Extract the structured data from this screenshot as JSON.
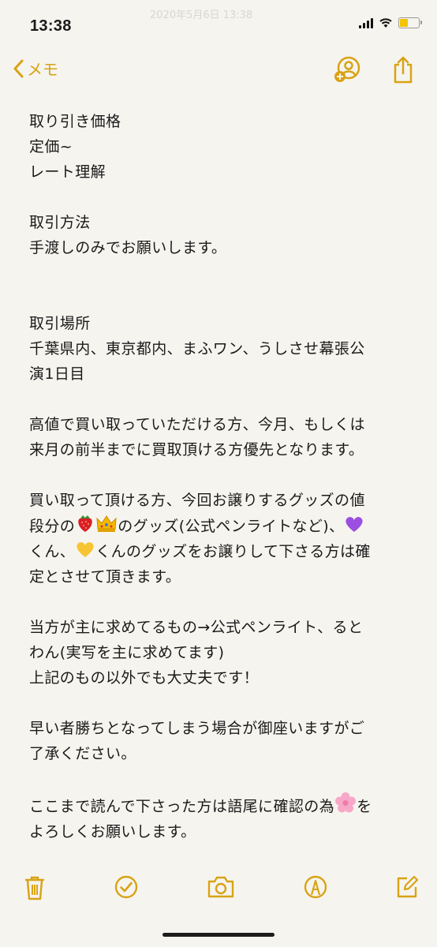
{
  "status_bar": {
    "time": "13:38",
    "ghost_text": "2020年5月6日 13:38"
  },
  "nav": {
    "back_label": "メモ"
  },
  "note": {
    "price_heading": "取り引き価格",
    "price_line1": "定価~",
    "price_line2": "レート理解",
    "method_heading": "取引方法",
    "method_text": "手渡しのみでお願いします。",
    "place_heading": "取引場所",
    "place_line1": "千葉県内、東京都内、まふワン、うしさせ幕張公",
    "place_line2": "演1日目",
    "priority_line1": "高値で買い取っていただける方、今月、もしくは",
    "priority_line2": "来月の前半までに買取頂ける方優先となります。",
    "trade_line1": "買い取って頂ける方、今回お譲りするグッズの値",
    "trade_line2a": "段分の",
    "trade_line2b": "のグッズ(公式ペンライトなど)、",
    "trade_line3a": "くん、",
    "trade_line3b": "くんのグッズをお譲りして下さる方は確",
    "trade_line4": "定とさせて頂きます。",
    "want_line1": "当方が主に求めてるもの→公式ペンライト、ると",
    "want_line2": "わん(実写を主に求めてます)",
    "want_line3": "上記のもの以外でも大丈夫です！",
    "first_line1": "早い者勝ちとなってしまう場合が御座いますがご",
    "first_line2": "了承ください。",
    "end_line1a": "ここまで読んで下さった方は語尾に確認の為",
    "end_line1b": "を",
    "end_line2": "よろしくお願いします。"
  },
  "emoji": [
    "strawberry-emoji",
    "crown-emoji",
    "purple-heart-emoji",
    "yellow-heart-emoji",
    "cherry-blossom-emoji"
  ],
  "toolbar": [
    "trash-icon",
    "checklist-icon",
    "camera-icon",
    "markup-icon",
    "compose-icon"
  ],
  "colors": {
    "accent": "#d8a314",
    "background": "#f6f4ef"
  }
}
